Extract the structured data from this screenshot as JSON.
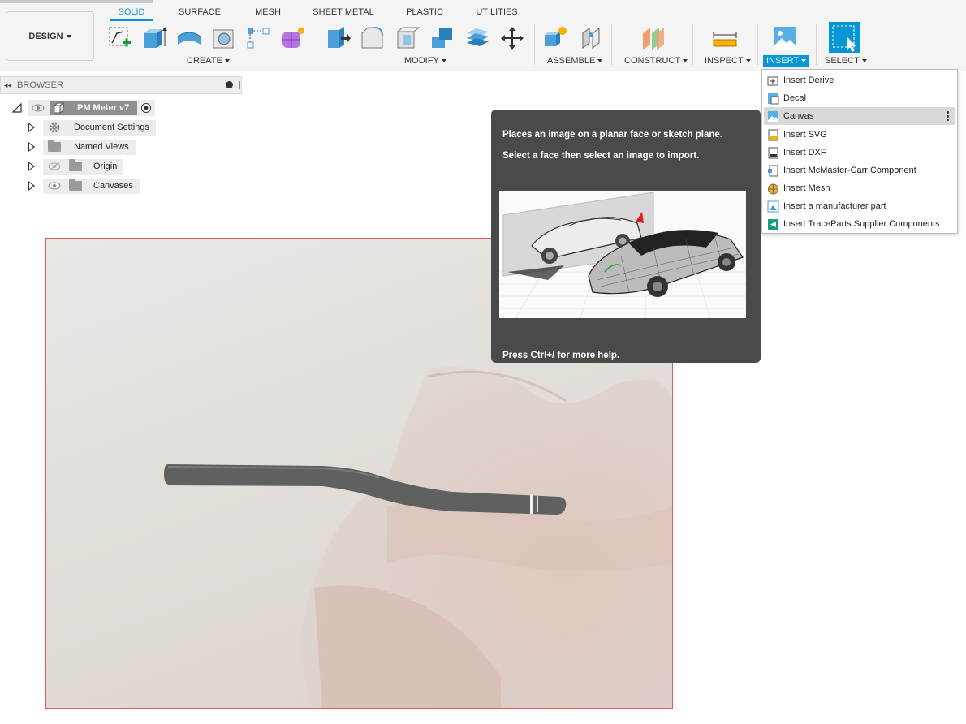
{
  "toolbar": {
    "workspace_label": "DESIGN",
    "tabs": [
      "SOLID",
      "SURFACE",
      "MESH",
      "SHEET METAL",
      "PLASTIC",
      "UTILITIES"
    ],
    "groups": {
      "create": "CREATE",
      "modify": "MODIFY",
      "assemble": "ASSEMBLE",
      "construct": "CONSTRUCT",
      "inspect": "INSPECT",
      "insert": "INSERT",
      "select": "SELECT"
    },
    "accent": "#0696d7"
  },
  "browser": {
    "title": "BROWSER",
    "root": "PM Meter v7",
    "items": [
      {
        "label": "Document Settings",
        "icon": "gear-icon"
      },
      {
        "label": "Named Views",
        "icon": "folder-icon"
      },
      {
        "label": "Origin",
        "icon": "folder-icon",
        "visibility": "hidden"
      },
      {
        "label": "Canvases",
        "icon": "folder-icon",
        "visibility": "visible"
      }
    ]
  },
  "insert_menu": {
    "items": [
      {
        "label": "Insert Derive",
        "icon": "derive-icon"
      },
      {
        "label": "Decal",
        "icon": "decal-icon"
      },
      {
        "label": "Canvas",
        "icon": "canvas-icon",
        "highlighted": true
      },
      {
        "label": "Insert SVG",
        "icon": "svg-icon"
      },
      {
        "label": "Insert DXF",
        "icon": "dxf-icon"
      },
      {
        "label": "Insert McMaster-Carr Component",
        "icon": "mcmaster-icon"
      },
      {
        "label": "Insert Mesh",
        "icon": "mesh-icon"
      },
      {
        "label": "Insert a manufacturer part",
        "icon": "manufacturer-part-icon"
      },
      {
        "label": "Insert TraceParts Supplier Components",
        "icon": "traceparts-icon"
      }
    ]
  },
  "tooltip": {
    "line1": "Places an image on a planar face or sketch plane.",
    "line2": "Select a face then select an image to import.",
    "footer": "Press Ctrl+/ for more help."
  }
}
